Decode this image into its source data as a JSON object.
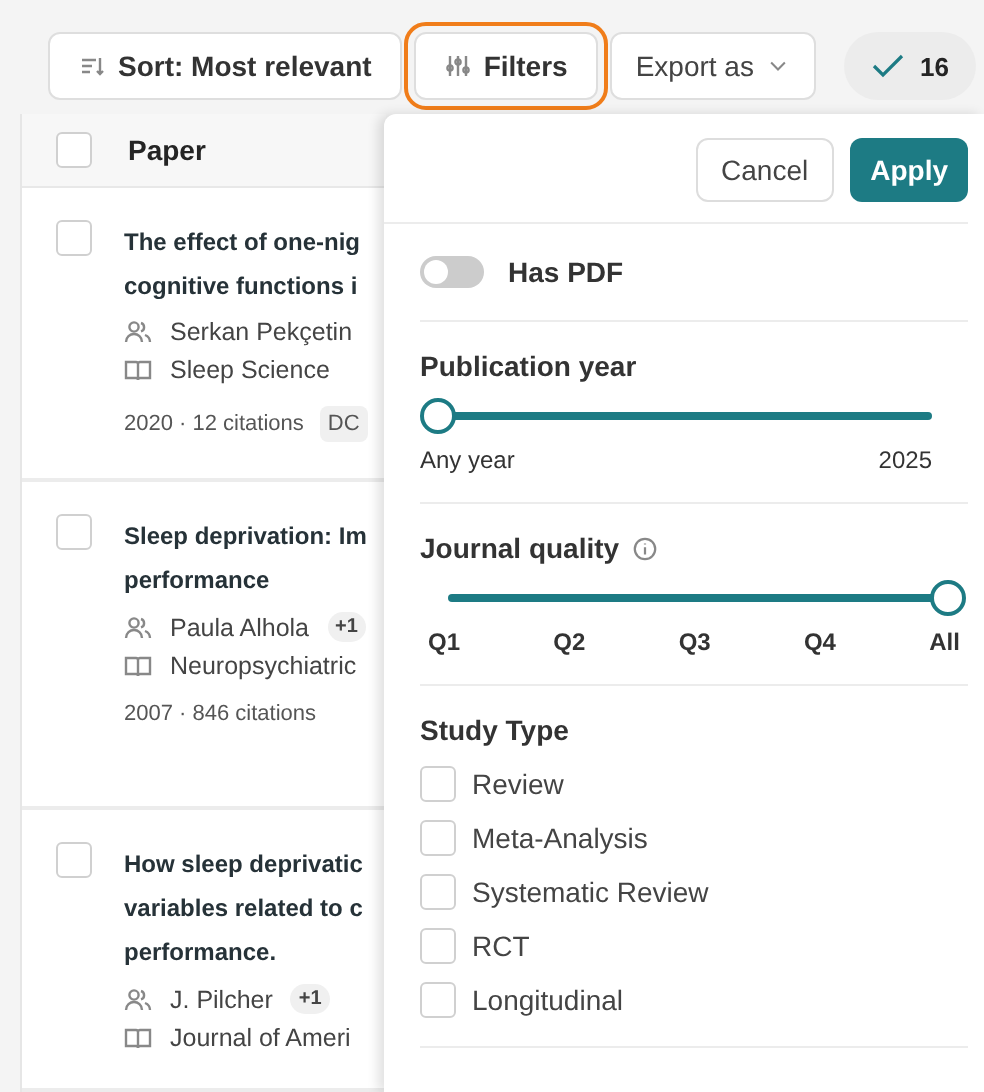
{
  "toolbar": {
    "sort_button": "Sort: Most relevant",
    "filters_button": {
      "label": "Filters",
      "highlighted": true
    },
    "export_button": "Export as",
    "selection_badge": "16"
  },
  "table": {
    "header": {
      "label": "Paper",
      "checked": false
    },
    "rows": [
      {
        "checked": false,
        "title_lines": [
          "The effect of one-nig",
          "cognitive functions i"
        ],
        "author": "Serkan Pekçetin",
        "more_authors": "",
        "journal": "Sleep Science",
        "meta": "2020 · 12 citations",
        "tag": "DC"
      },
      {
        "checked": false,
        "title_lines": [
          "Sleep deprivation: Im",
          "performance"
        ],
        "author": "Paula Alhola",
        "more_authors": "+1",
        "journal": "Neuropsychiatric",
        "meta": "2007 · 846 citations",
        "tag": ""
      },
      {
        "checked": false,
        "title_lines": [
          "How sleep deprivatic",
          "variables related to c",
          "performance."
        ],
        "author": "J. Pilcher",
        "more_authors": "+1",
        "journal": "Journal of Ameri",
        "meta": "",
        "tag": ""
      }
    ]
  },
  "filters": {
    "cancel": "Cancel",
    "apply": "Apply",
    "has_pdf": {
      "label": "Has PDF",
      "on": false
    },
    "publication_year": {
      "title": "Publication year",
      "level": 0,
      "min_label": "Any year",
      "max_label": "2025"
    },
    "journal_quality": {
      "title": "Journal quality",
      "level": 1,
      "ticks": [
        "Q1",
        "Q2",
        "Q3",
        "Q4",
        "All"
      ]
    },
    "study_type": {
      "title": "Study Type",
      "options": [
        {
          "label": "Review",
          "checked": false
        },
        {
          "label": "Meta-Analysis",
          "checked": false
        },
        {
          "label": "Systematic Review",
          "checked": false
        },
        {
          "label": "RCT",
          "checked": false
        },
        {
          "label": "Longitudinal",
          "checked": false
        }
      ]
    }
  }
}
